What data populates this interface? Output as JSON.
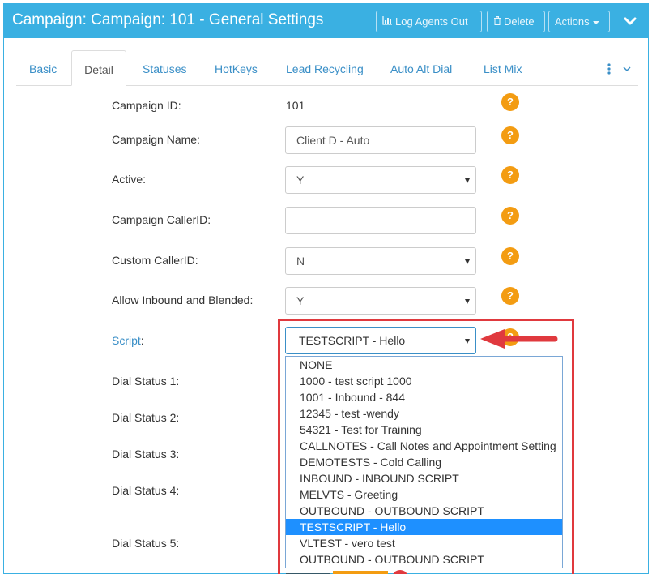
{
  "header": {
    "title": "Campaign: Campaign: 101 - General Settings",
    "log_agents_out": "Log Agents Out",
    "delete": "Delete",
    "actions": "Actions",
    "icons": [
      "bar-chart-icon",
      "trash-icon",
      "chevron-down-icon"
    ]
  },
  "tabs": [
    {
      "label": "Basic",
      "active": false
    },
    {
      "label": "Detail",
      "active": true
    },
    {
      "label": "Statuses",
      "active": false
    },
    {
      "label": "HotKeys",
      "active": false
    },
    {
      "label": "Lead Recycling",
      "active": false
    },
    {
      "label": "Auto Alt Dial",
      "active": false
    },
    {
      "label": "List Mix",
      "active": false
    }
  ],
  "form": {
    "campaign_id": {
      "label": "Campaign ID:",
      "value": "101"
    },
    "campaign_name": {
      "label": "Campaign Name:",
      "value": "Client D - Auto"
    },
    "active": {
      "label": "Active:",
      "value": "Y"
    },
    "campaign_callerid": {
      "label": "Campaign CallerID:",
      "value": ""
    },
    "custom_callerid": {
      "label": "Custom CallerID:",
      "value": "N"
    },
    "allow_inbound": {
      "label": "Allow Inbound and Blended:",
      "value": "Y"
    },
    "script": {
      "label": "Script",
      "colon": ":",
      "value": "TESTSCRIPT - Hello"
    },
    "dial_status_1": {
      "label": "Dial Status 1:"
    },
    "dial_status_2": {
      "label": "Dial Status 2:"
    },
    "dial_status_3": {
      "label": "Dial Status 3:"
    },
    "dial_status_4": {
      "label": "Dial Status 4:"
    },
    "dial_status_5": {
      "label": "Dial Status 5:"
    },
    "help_glyph": "?"
  },
  "script_options": [
    "NONE",
    "1000 - test script 1000",
    "1001 - Inbound - 844",
    "12345 - test -wendy",
    "54321 - Test for Training",
    "CALLNOTES - Call Notes and Appointment Setting",
    "DEMOTESTS - Cold Calling",
    "INBOUND - INBOUND SCRIPT",
    "MELVTS - Greeting",
    "OUTBOUND - OUTBOUND SCRIPT",
    "TESTSCRIPT - Hello",
    "VLTEST - vero test",
    "OUTBOUND - OUTBOUND SCRIPT"
  ],
  "selected_option_index": 10,
  "colors": {
    "header": "#3ab0e2",
    "link": "#3a8fc7",
    "help": "#f39c12",
    "highlight": "#e0393e",
    "selected": "#1e90ff"
  }
}
